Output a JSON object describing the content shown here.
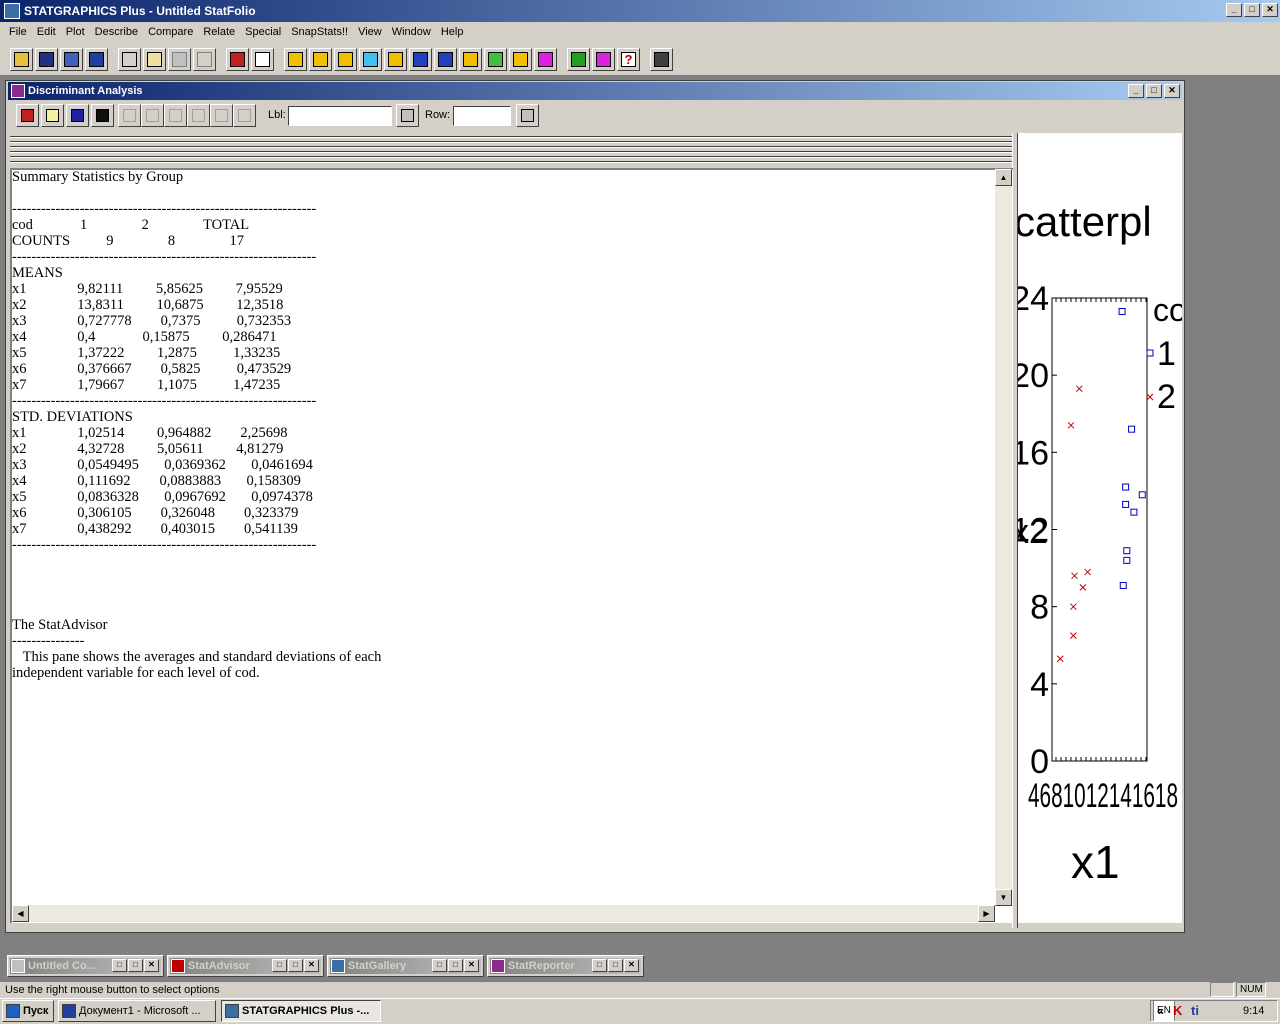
{
  "app": {
    "title": "STATGRAPHICS Plus - Untitled StatFolio",
    "caption_min": "_",
    "caption_max": "□",
    "caption_close": "✕"
  },
  "menu": [
    "File",
    "Edit",
    "Plot",
    "Describe",
    "Compare",
    "Relate",
    "Special",
    "SnapStats!!",
    "View",
    "Window",
    "Help"
  ],
  "toolbar_icons": [
    "open-icon",
    "save-icon",
    "datasheet-icon",
    "save-data-icon",
    "cut-icon",
    "copy-icon",
    "paste-icon",
    "undo-icon",
    "print-icon",
    "print-preview-icon",
    "scatterplot-icon",
    "summary-icon",
    "histogram-icon",
    "cross-icon",
    "xy-plot-icon",
    "series-icon",
    "normal-icon",
    "line-icon",
    "globe-icon",
    "bars-icon",
    "glm-icon",
    "advisor-icon",
    "wizard-icon",
    "help-icon",
    "calculator-icon"
  ],
  "child": {
    "title": "Discriminant Analysis",
    "lbl_label": "Lbl:",
    "lbl_value": "",
    "row_label": "Row:",
    "row_value": ""
  },
  "summary": {
    "title": "Summary Statistics by Group",
    "rule": "---------------------------------------------------------------",
    "header": [
      "cod",
      "1",
      "2",
      "TOTAL"
    ],
    "counts": [
      "COUNTS",
      "9",
      "8",
      "17"
    ],
    "means_label": "MEANS",
    "means": [
      [
        "x1",
        "9,82111",
        "5,85625",
        "7,95529"
      ],
      [
        "x2",
        "13,8311",
        "10,6875",
        "12,3518"
      ],
      [
        "x3",
        "0,727778",
        "0,7375",
        "0,732353"
      ],
      [
        "x4",
        "0,4",
        "0,15875",
        "0,286471"
      ],
      [
        "x5",
        "1,37222",
        "1,2875",
        "1,33235"
      ],
      [
        "x6",
        "0,376667",
        "0,5825",
        "0,473529"
      ],
      [
        "x7",
        "1,79667",
        "1,1075",
        "1,47235"
      ]
    ],
    "sd_label": "STD. DEVIATIONS",
    "sds": [
      [
        "x1",
        "1,02514",
        "0,964882",
        "2,25698"
      ],
      [
        "x2",
        "4,32728",
        "5,05611",
        "4,81279"
      ],
      [
        "x3",
        "0,0549495",
        "0,0369362",
        "0,0461694"
      ],
      [
        "x4",
        "0,111692",
        "0,0883883",
        "0,158309"
      ],
      [
        "x5",
        "0,0836328",
        "0,0967692",
        "0,0974378"
      ],
      [
        "x6",
        "0,306105",
        "0,326048",
        "0,323379"
      ],
      [
        "x7",
        "0,438292",
        "0,403015",
        "0,541139"
      ]
    ],
    "advisor_title": "The StatAdvisor",
    "advisor_rule": "---------------",
    "advisor_text_1": "   This pane shows the averages and standard deviations of each",
    "advisor_text_2": "independent variable for each level of cod."
  },
  "chart": {
    "title_fragment": "catterpl",
    "legend_title_fragment": "co",
    "legend": [
      {
        "label": "1",
        "marker": "square",
        "color": "#0000c0"
      },
      {
        "label": "2",
        "marker": "cross",
        "color": "#c00000"
      }
    ],
    "y_ticks": [
      "0",
      "4",
      "8",
      "12",
      "16",
      "20",
      "24"
    ],
    "x_tick_strip": "4681012141618",
    "x_label": "x1",
    "y_label_fragment": "x2"
  },
  "chart_data": {
    "type": "scatter",
    "ylim": [
      0,
      24
    ],
    "y_ticks": [
      0,
      4,
      8,
      12,
      16,
      20,
      24
    ],
    "legend_placement": "right",
    "series": [
      {
        "name": "1",
        "marker": "square",
        "color": "#0000c0",
        "points": [
          [
            9.9,
            23.3
          ],
          [
            10.7,
            17.2
          ],
          [
            10.2,
            14.2
          ],
          [
            10.2,
            13.3
          ],
          [
            10.9,
            12.9
          ],
          [
            11.6,
            13.8
          ],
          [
            10.3,
            10.4
          ],
          [
            10.3,
            10.9
          ],
          [
            10.0,
            9.1
          ]
        ]
      },
      {
        "name": "2",
        "marker": "cross",
        "color": "#c00000",
        "points": [
          [
            6.3,
            19.3
          ],
          [
            5.6,
            17.4
          ],
          [
            5.9,
            9.6
          ],
          [
            7.0,
            9.8
          ],
          [
            6.6,
            9.0
          ],
          [
            5.8,
            8.0
          ],
          [
            5.8,
            6.5
          ],
          [
            4.7,
            5.3
          ]
        ]
      }
    ]
  },
  "minimized": [
    {
      "label": "Untitled Co...",
      "color": "#c0c0c0"
    },
    {
      "label": "StatAdvisor",
      "color": "#c00000"
    },
    {
      "label": "StatGallery",
      "color": "#3a6ea5"
    },
    {
      "label": "StatReporter",
      "color": "#8b2b8b"
    }
  ],
  "status": {
    "message": "Use the right mouse button to select options",
    "num": "NUM"
  },
  "taskbar": {
    "start": "Пуск",
    "tasks": [
      "Документ1 - Microsoft ...",
      "STATGRAPHICS Plus -..."
    ],
    "lang": "EN",
    "time": "9:14"
  }
}
